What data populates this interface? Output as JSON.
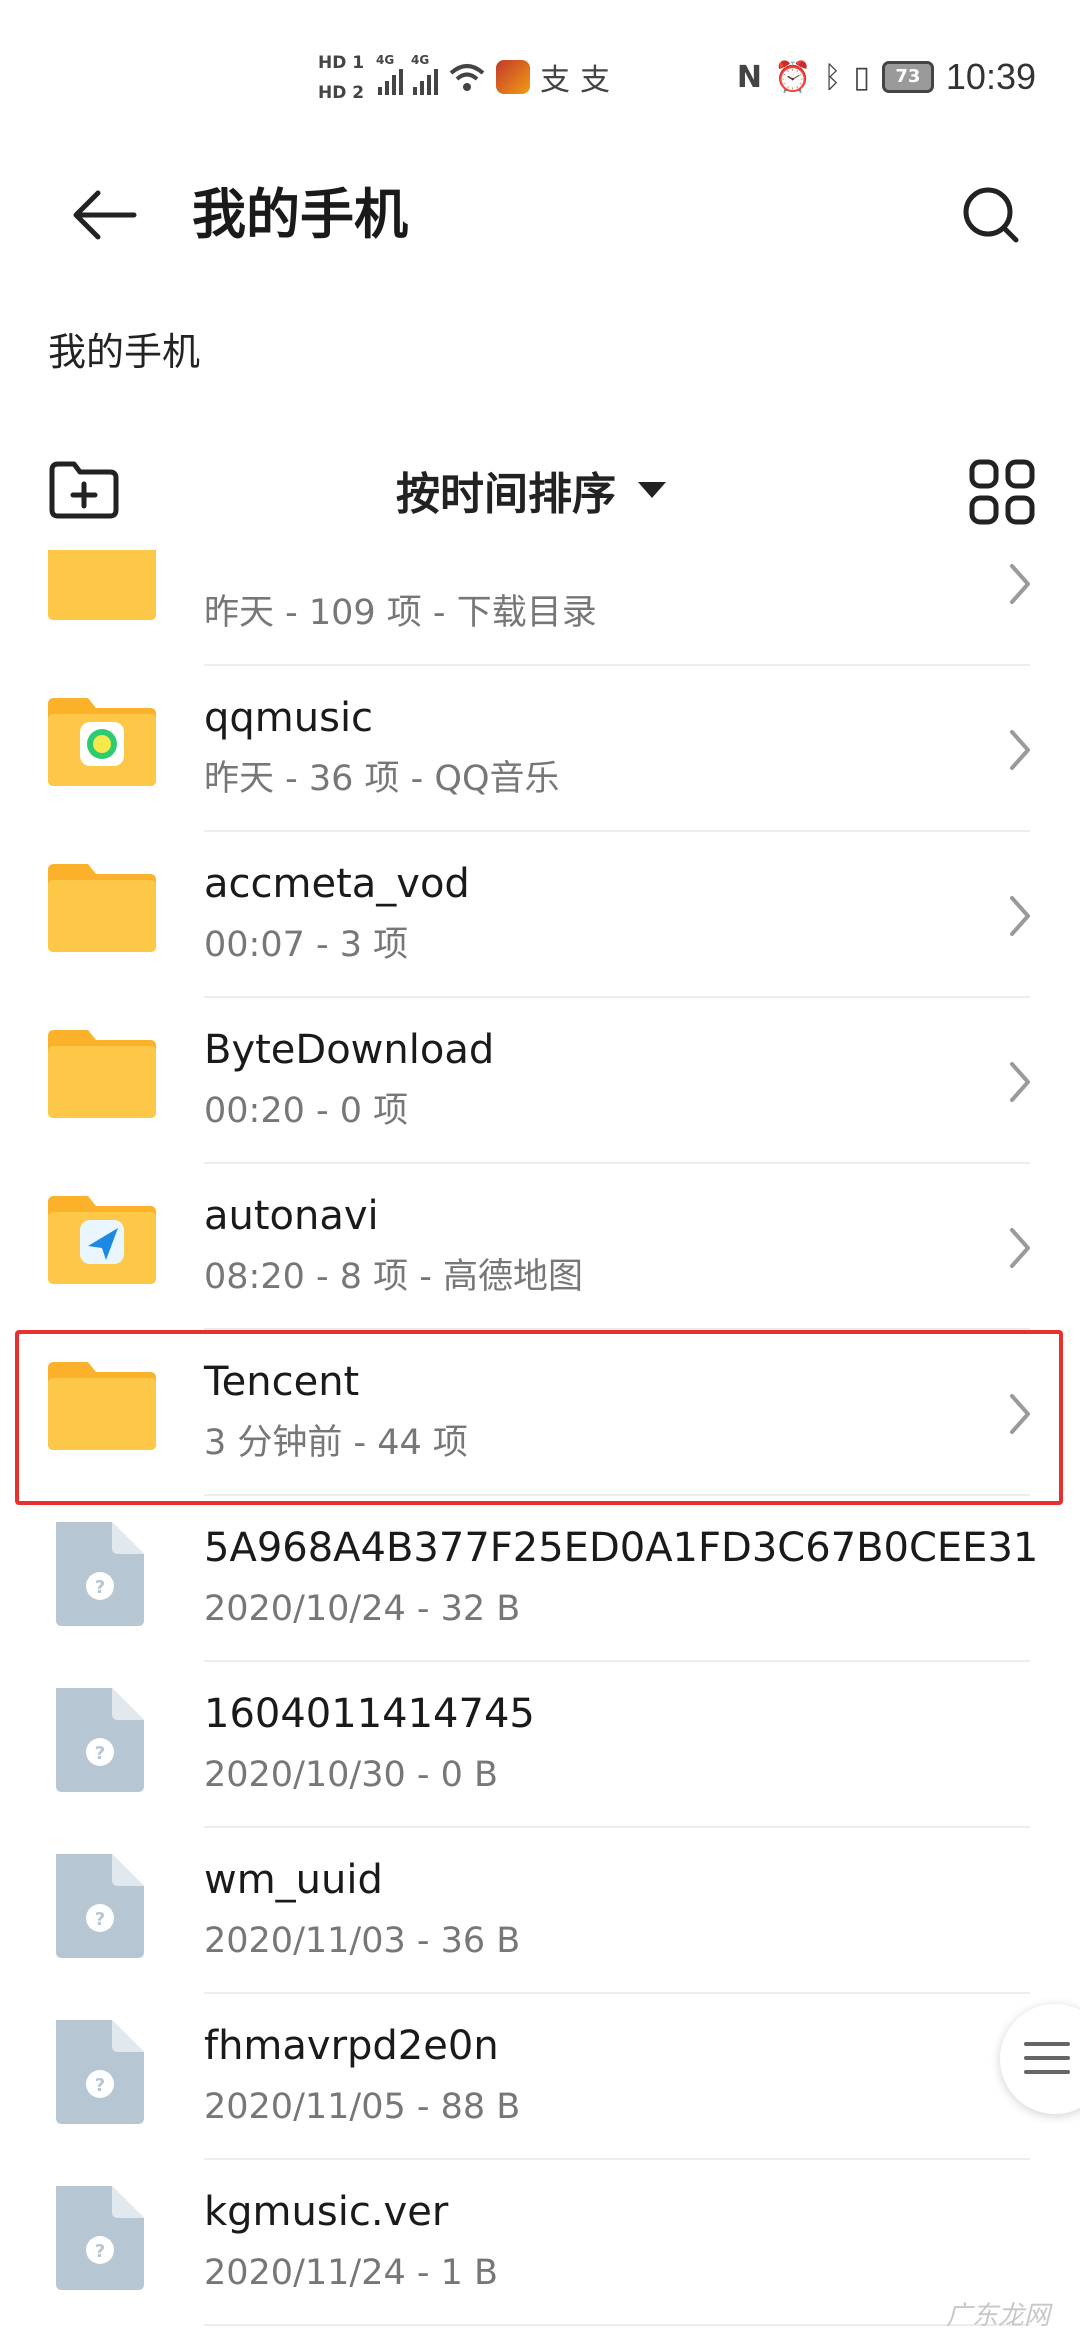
{
  "status_bar": {
    "hd_labels": [
      "HD 1",
      "HD 2"
    ],
    "network_labels": [
      "4G",
      "4G"
    ],
    "chat_icons": [
      "支",
      "支"
    ],
    "battery": "73",
    "time": "10:39"
  },
  "header": {
    "title": "我的手机",
    "back_icon": "arrow-left-icon",
    "search_icon": "search-icon"
  },
  "breadcrumb": "我的手机",
  "toolbar": {
    "sort_label": "按时间排序",
    "new_folder_icon": "folder-plus-icon",
    "view_icon": "grid-view-icon"
  },
  "rows": [
    {
      "name": "",
      "meta": "昨天 - 109 项 - 下载目录",
      "type": "folder"
    },
    {
      "name": "qqmusic",
      "meta": "昨天 - 36 项 - QQ音乐",
      "type": "folder-qqmusic"
    },
    {
      "name": "accmeta_vod",
      "meta": "00:07 - 3 项",
      "type": "folder"
    },
    {
      "name": "ByteDownload",
      "meta": "00:20 - 0 项",
      "type": "folder"
    },
    {
      "name": "autonavi",
      "meta": "08:20 - 8 项 - 高德地图",
      "type": "folder-autonavi"
    },
    {
      "name": "Tencent",
      "meta": "3 分钟前 - 44 项",
      "type": "folder"
    },
    {
      "name": "5A968A4B377F25ED0A1FD3C67B0CEE31",
      "meta": "2020/10/24 - 32 B",
      "type": "file"
    },
    {
      "name": "1604011414745",
      "meta": "2020/10/30 - 0 B",
      "type": "file"
    },
    {
      "name": "wm_uuid",
      "meta": "2020/11/03 - 36 B",
      "type": "file"
    },
    {
      "name": "fhmavrpd2e0n",
      "meta": "2020/11/05 - 88 B",
      "type": "file"
    },
    {
      "name": "kgmusic.ver",
      "meta": "2020/11/24 - 1 B",
      "type": "file"
    }
  ],
  "watermark": "广东龙网",
  "colors": {
    "folder": "#fdc748",
    "folder_tab": "#fbb22a",
    "file": "#b7c6d3",
    "highlight": "#e8302c"
  }
}
